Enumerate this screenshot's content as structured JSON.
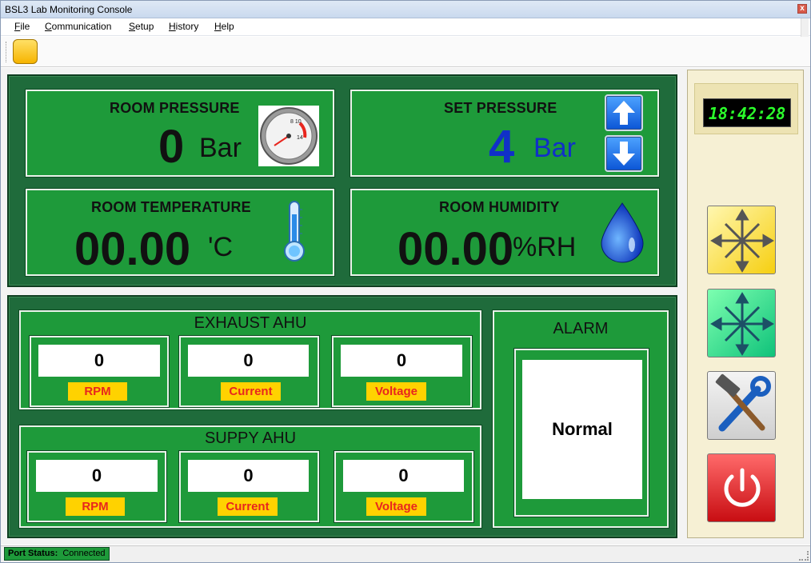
{
  "window": {
    "title": "BSL3 Lab Monitoring Console",
    "close_glyph": "x"
  },
  "menu": {
    "items": [
      "File",
      "Communication",
      "Setup",
      "History",
      "Help"
    ]
  },
  "room_pressure": {
    "title": "ROOM PRESSURE",
    "value": "0",
    "unit": "Bar"
  },
  "set_pressure": {
    "title": "SET PRESSURE",
    "value": "4",
    "unit": "Bar"
  },
  "room_temperature": {
    "title": "ROOM TEMPERATURE",
    "value": "00.00",
    "unit": "'C"
  },
  "room_humidity": {
    "title": "ROOM HUMIDITY",
    "value": "00.00",
    "unit": "%RH"
  },
  "exhaust_ahu": {
    "title": "EXHAUST AHU",
    "meters": [
      {
        "value": "0",
        "label": "RPM"
      },
      {
        "value": "0",
        "label": "Current"
      },
      {
        "value": "0",
        "label": "Voltage"
      }
    ]
  },
  "supply_ahu": {
    "title": "SUPPY AHU",
    "meters": [
      {
        "value": "0",
        "label": "RPM"
      },
      {
        "value": "0",
        "label": "Current"
      },
      {
        "value": "0",
        "label": "Voltage"
      }
    ]
  },
  "alarm": {
    "title": "ALARM",
    "status": "Normal"
  },
  "clock": {
    "time": "18:42:28"
  },
  "status": {
    "label": "Port Status:",
    "value": "Connected"
  },
  "colors": {
    "panel_green": "#1f6b3b",
    "card_green": "#1e9a3a",
    "tag_yellow": "#ffd200",
    "tag_red_text": "#e8261e",
    "setpoint_blue": "#1030c8",
    "clock_green": "#2bff2b"
  },
  "icons": {
    "pressure_gauge": "pressure-gauge-icon",
    "thermometer": "thermometer-icon",
    "water_drop": "water-drop-icon",
    "arrow_up": "arrow-up-icon",
    "arrow_down": "arrow-down-icon",
    "move_yellow": "move-arrows-yellow-icon",
    "move_green": "move-arrows-green-icon",
    "tools": "tools-icon",
    "power": "power-icon"
  }
}
